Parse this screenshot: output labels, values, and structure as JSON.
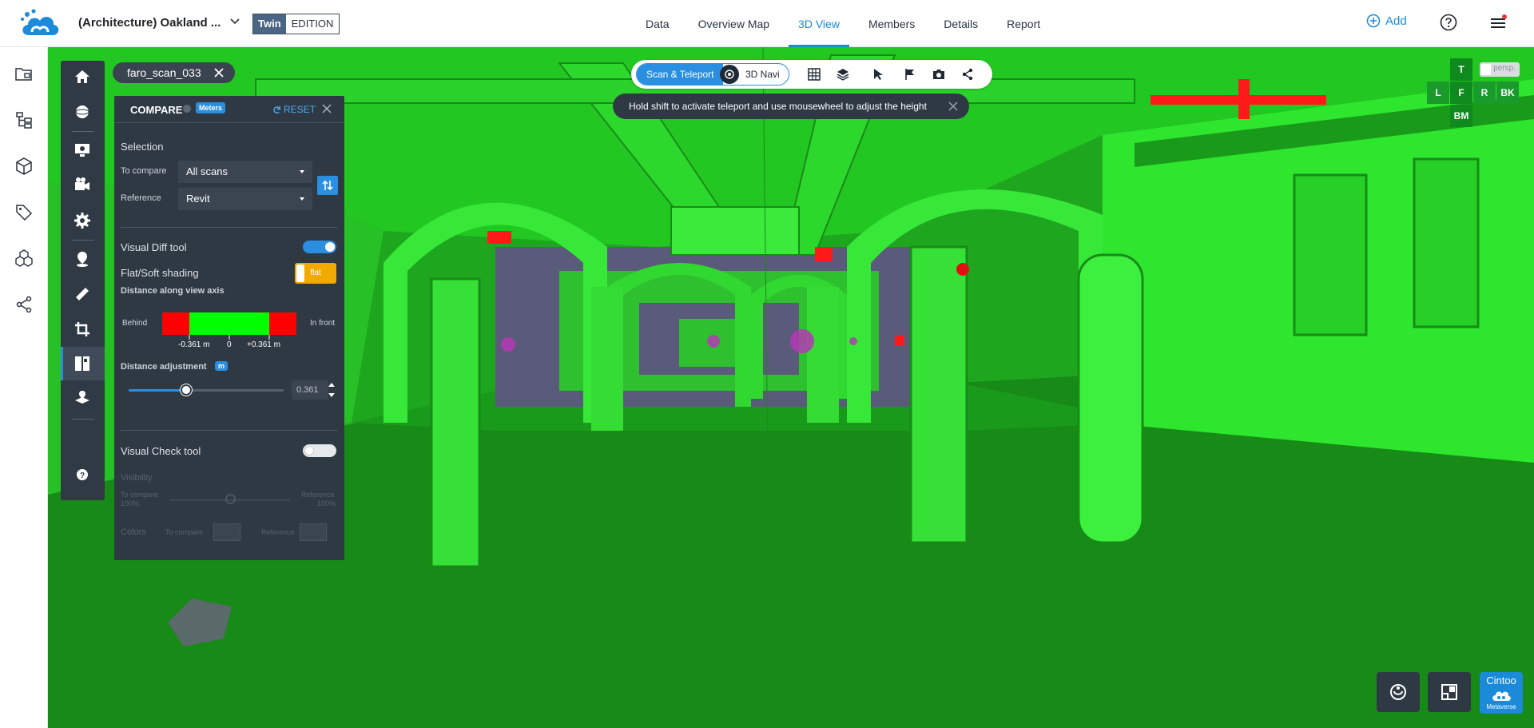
{
  "header": {
    "project_title": "(Architecture) Oakland ...",
    "edition_twin": "Twin",
    "edition_label": "EDITION",
    "nav": [
      "Data",
      "Overview Map",
      "3D View",
      "Members",
      "Details",
      "Report"
    ],
    "active_nav": "3D View",
    "add_label": "Add"
  },
  "scan_tag": {
    "label": "faro_scan_033"
  },
  "compare": {
    "title": "COMPARE",
    "unit_badge": "Meters",
    "reset_label": "RESET",
    "selection_label": "Selection",
    "to_compare_label": "To compare",
    "to_compare_value": "All scans",
    "reference_label": "Reference",
    "reference_value": "Revit",
    "visual_diff_label": "Visual Diff tool",
    "visual_diff_on": true,
    "shading_label": "Flat/Soft shading",
    "shading_value": "flat",
    "distance_axis_label": "Distance along view axis",
    "behind_label": "Behind",
    "in_front_label": "In front",
    "tick_neg": "-0.361 m",
    "tick_zero": "0",
    "tick_pos": "+0.361 m",
    "distance_adjust_label": "Distance adjustment",
    "distance_adjust_badge": "m",
    "distance_value": "0.361",
    "distance_fraction": 0.37,
    "visual_check_label": "Visual Check tool",
    "visual_check_on": false,
    "visibility_label": "Visibility",
    "vis_left": "To compare",
    "vis_left_pct": "100%",
    "vis_right": "Reference",
    "vis_right_pct": "100%",
    "colors_label": "Colors",
    "colors_to_compare": "To compare",
    "colors_reference": "Reference"
  },
  "viewer_bar": {
    "mode_on": "Scan & Teleport",
    "mode_off": "3D Navi"
  },
  "hint": {
    "text": "Hold shift to activate teleport and use mousewheel to adjust the height"
  },
  "view_cube": {
    "top": "T",
    "left": "L",
    "front": "F",
    "right": "R",
    "back": "BK",
    "bottom": "BM",
    "persp": "persp."
  },
  "metaverse": {
    "line1": "Cintoo",
    "line2": "Metaverse"
  },
  "colors": {
    "accent": "#1a8ad9",
    "panel": "#2f3944",
    "diff_green": "#00ff00",
    "diff_red": "#ff0000",
    "toggle_flat": "#f2a900"
  }
}
